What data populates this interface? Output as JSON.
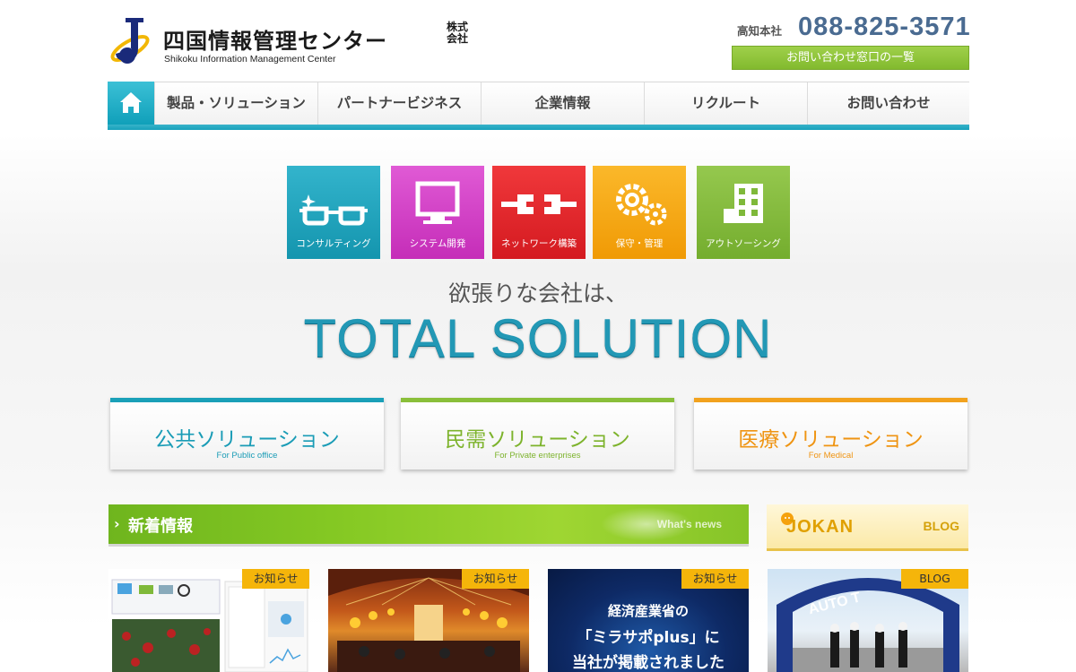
{
  "header": {
    "logo_name": "四国情報管理センター",
    "logo_kaisha_1": "株式",
    "logo_kaisha_2": "会社",
    "logo_en": "Shikoku Information Management Center",
    "tel_label": "高知本社",
    "tel_number": "088-825-3571",
    "contact_button": "お問い合わせ窓口の一覧"
  },
  "nav": {
    "home_icon": "home-icon",
    "items": [
      "製品・ソリューション",
      "パートナービジネス",
      "企業情報",
      "リクルート",
      "お問い合わせ"
    ]
  },
  "tiles": [
    {
      "label": "コンサルティング",
      "icon": "glasses-icon",
      "color": "#1aa3bd"
    },
    {
      "label": "システム開発",
      "icon": "monitor-icon",
      "color": "#d23fc7"
    },
    {
      "label": "ネットワーク構築",
      "icon": "plug-icon",
      "color": "#e8262b"
    },
    {
      "label": "保守・管理",
      "icon": "gears-icon",
      "color": "#f5a10d"
    },
    {
      "label": "アウトソーシング",
      "icon": "building-icon",
      "color": "#7fb93a"
    }
  ],
  "hero": {
    "catch": "欲張りな会社は、",
    "headline": "TOTAL SOLUTION"
  },
  "solutions": [
    {
      "title": "公共ソリューション",
      "sub": "For Public office",
      "color": "#1aa0b8"
    },
    {
      "title": "民需ソリューション",
      "sub": "For Private enterprises",
      "color": "#8abf3a"
    },
    {
      "title": "医療ソリューション",
      "sub": "For Medical",
      "color": "#f2a21e"
    }
  ],
  "news": {
    "title": "新着情報",
    "sub": "What's news"
  },
  "blog": {
    "logo": "JOKAN",
    "label": "BLOG"
  },
  "cards": [
    {
      "badge": "お知らせ"
    },
    {
      "badge": "お知らせ"
    },
    {
      "badge": "お知らせ",
      "line1": "経済産業省の",
      "line2": "「ミラサポplus」に",
      "line3": "当社が掲載されました"
    },
    {
      "badge": "BLOG",
      "banner_text": "AUTO T"
    }
  ]
}
